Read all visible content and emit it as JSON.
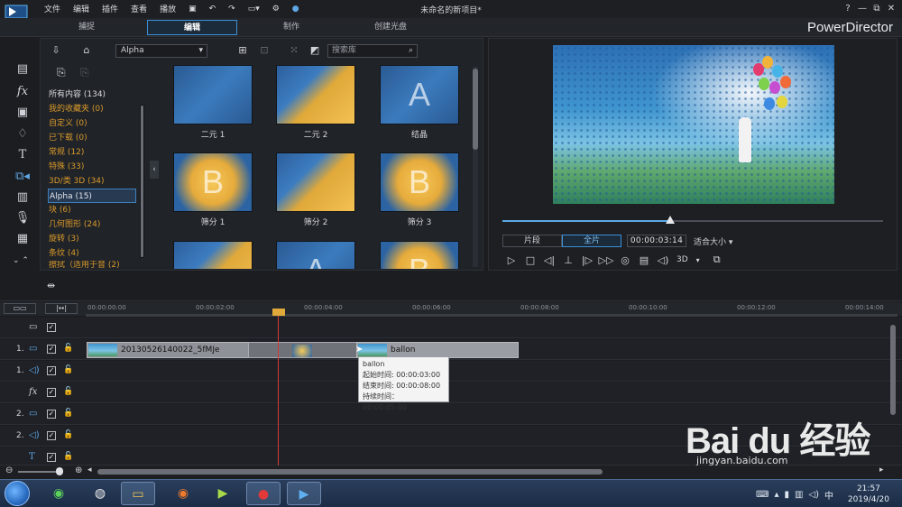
{
  "app": {
    "menus": [
      "文件",
      "编辑",
      "插件",
      "查看",
      "播放"
    ],
    "window_title": "未命名的新项目*",
    "brand": "PowerDirector",
    "window_controls": [
      "?",
      "—",
      "⧉",
      "✕"
    ]
  },
  "mode_tabs": [
    "捕捉",
    "编辑",
    "制作",
    "创建光盘"
  ],
  "active_mode": "编辑",
  "library": {
    "category_select": "Alpha",
    "search_placeholder": "搜索库",
    "categories": [
      "所有内容 (134)",
      "我的收藏夹 (0)",
      "自定义 (0)",
      "已下载 (0)",
      "常规 (12)",
      "特殊 (33)",
      "3D/类 3D (34)",
      "Alpha (15)",
      "块 (6)",
      "几何图形 (24)",
      "旋转 (3)",
      "条纹 (4)",
      "擦拭（适用于音 (2)"
    ],
    "selected_category_index": 7,
    "thumbnails": [
      {
        "label": "二元 1",
        "glyph": ""
      },
      {
        "label": "二元 2",
        "glyph": ""
      },
      {
        "label": "结晶",
        "glyph": "A"
      },
      {
        "label": "筛分 1",
        "glyph": "B"
      },
      {
        "label": "筛分 2",
        "glyph": ""
      },
      {
        "label": "筛分 3",
        "glyph": "B"
      },
      {
        "label": "",
        "glyph": ""
      },
      {
        "label": "",
        "glyph": "A"
      },
      {
        "label": "",
        "glyph": "B"
      }
    ]
  },
  "preview": {
    "segment_clip": "片段",
    "segment_movie": "全片",
    "active_segment": "全片",
    "timecode": "00:00:03:14",
    "fit": "适合大小",
    "three_d": "3D",
    "progress": 0.44
  },
  "timeline": {
    "ruler": [
      "00:00:00:00",
      "00:00:02:00",
      "00:00:04:00",
      "00:00:06:00",
      "00:00:08:00",
      "00:00:10:00",
      "00:00:12:00",
      "00:00:14:00"
    ],
    "tracks": [
      {
        "num": "",
        "icon": "▭"
      },
      {
        "num": "1.",
        "icon": "▭"
      },
      {
        "num": "1.",
        "icon": "◁)"
      },
      {
        "num": "",
        "icon": "fx"
      },
      {
        "num": "2.",
        "icon": "▭"
      },
      {
        "num": "2.",
        "icon": "◁)"
      },
      {
        "num": "",
        "icon": "T"
      }
    ],
    "clip1_label": "20130526140022_5fMJe",
    "clip2_label": "ballon",
    "tooltip": {
      "title": "ballon",
      "start": "起始时间: 00:00:03:00",
      "end": "结束时间: 00:00:08:00",
      "duration": "持续时间： 00:00:05:00"
    }
  },
  "taskbar": {
    "time": "21:57",
    "date": "2019/4/20"
  },
  "watermark": {
    "logo": "Bai du 经验",
    "url": "jingyan.baidu.com"
  },
  "colors": {
    "accent": "#3d8fd6",
    "category_orange": "#d99a2b",
    "playhead": "#d43a3a"
  }
}
